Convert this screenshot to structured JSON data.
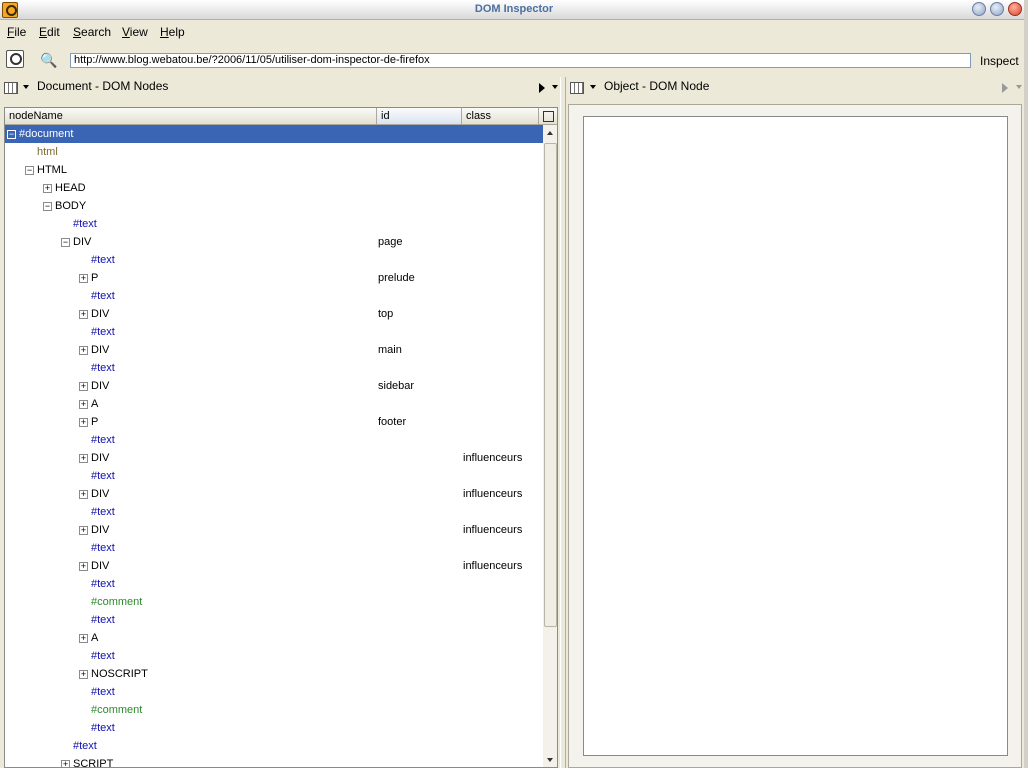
{
  "window": {
    "title": "DOM Inspector"
  },
  "menu": {
    "file": "File",
    "file_key": "F",
    "file_rest": "ile",
    "edit": "Edit",
    "edit_key": "E",
    "edit_rest": "dit",
    "search": "Search",
    "search_key": "S",
    "search_rest": "earch",
    "view": "View",
    "view_key": "V",
    "view_rest": "iew",
    "help": "Help",
    "help_key": "H",
    "help_rest": "elp"
  },
  "toolbar": {
    "url": "http://www.blog.webatou.be/?2006/11/05/utiliser-dom-inspector-de-firefox",
    "inspect_label": "Inspect"
  },
  "left_pane": {
    "title": "Document - DOM Nodes",
    "columns": {
      "nodename": "nodeName",
      "id": "id",
      "class": "class"
    },
    "rows": [
      {
        "name": "#document",
        "id": "",
        "class": "",
        "toggle": "−",
        "type": "normal",
        "level": 0
      },
      {
        "name": "html",
        "id": "",
        "class": "",
        "toggle": "",
        "type": "dt",
        "level": 1
      },
      {
        "name": "HTML",
        "id": "",
        "class": "",
        "toggle": "−",
        "type": "normal",
        "level": 1
      },
      {
        "name": "HEAD",
        "id": "",
        "class": "",
        "toggle": "+",
        "type": "normal",
        "level": 2
      },
      {
        "name": "BODY",
        "id": "",
        "class": "",
        "toggle": "−",
        "type": "normal",
        "level": 2
      },
      {
        "name": "#text",
        "id": "",
        "class": "",
        "toggle": "",
        "type": "text",
        "level": 3
      },
      {
        "name": "DIV",
        "id": "page",
        "class": "",
        "toggle": "−",
        "type": "normal",
        "level": 3
      },
      {
        "name": "#text",
        "id": "",
        "class": "",
        "toggle": "",
        "type": "text",
        "level": 4
      },
      {
        "name": "P",
        "id": "prelude",
        "class": "",
        "toggle": "+",
        "type": "normal",
        "level": 4
      },
      {
        "name": "#text",
        "id": "",
        "class": "",
        "toggle": "",
        "type": "text",
        "level": 4
      },
      {
        "name": "DIV",
        "id": "top",
        "class": "",
        "toggle": "+",
        "type": "normal",
        "level": 4
      },
      {
        "name": "#text",
        "id": "",
        "class": "",
        "toggle": "",
        "type": "text",
        "level": 4
      },
      {
        "name": "DIV",
        "id": "main",
        "class": "",
        "toggle": "+",
        "type": "normal",
        "level": 4
      },
      {
        "name": "#text",
        "id": "",
        "class": "",
        "toggle": "",
        "type": "text",
        "level": 4
      },
      {
        "name": "DIV",
        "id": "sidebar",
        "class": "",
        "toggle": "+",
        "type": "normal",
        "level": 4
      },
      {
        "name": "A",
        "id": "",
        "class": "",
        "toggle": "+",
        "type": "normal",
        "level": 4
      },
      {
        "name": "P",
        "id": "footer",
        "class": "",
        "toggle": "+",
        "type": "normal",
        "level": 4
      },
      {
        "name": "#text",
        "id": "",
        "class": "",
        "toggle": "",
        "type": "text",
        "level": 4
      },
      {
        "name": "DIV",
        "id": "",
        "class": "influenceurs",
        "toggle": "+",
        "type": "normal",
        "level": 4
      },
      {
        "name": "#text",
        "id": "",
        "class": "",
        "toggle": "",
        "type": "text",
        "level": 4
      },
      {
        "name": "DIV",
        "id": "",
        "class": "influenceurs",
        "toggle": "+",
        "type": "normal",
        "level": 4
      },
      {
        "name": "#text",
        "id": "",
        "class": "",
        "toggle": "",
        "type": "text",
        "level": 4
      },
      {
        "name": "DIV",
        "id": "",
        "class": "influenceurs",
        "toggle": "+",
        "type": "normal",
        "level": 4
      },
      {
        "name": "#text",
        "id": "",
        "class": "",
        "toggle": "",
        "type": "text",
        "level": 4
      },
      {
        "name": "DIV",
        "id": "",
        "class": "influenceurs",
        "toggle": "+",
        "type": "normal",
        "level": 4
      },
      {
        "name": "#text",
        "id": "",
        "class": "",
        "toggle": "",
        "type": "text",
        "level": 4
      },
      {
        "name": "#comment",
        "id": "",
        "class": "",
        "toggle": "",
        "type": "comment",
        "level": 4
      },
      {
        "name": "#text",
        "id": "",
        "class": "",
        "toggle": "",
        "type": "text",
        "level": 4
      },
      {
        "name": "A",
        "id": "",
        "class": "",
        "toggle": "+",
        "type": "normal",
        "level": 4
      },
      {
        "name": "#text",
        "id": "",
        "class": "",
        "toggle": "",
        "type": "text",
        "level": 4
      },
      {
        "name": "NOSCRIPT",
        "id": "",
        "class": "",
        "toggle": "+",
        "type": "normal",
        "level": 4
      },
      {
        "name": "#text",
        "id": "",
        "class": "",
        "toggle": "",
        "type": "text",
        "level": 4
      },
      {
        "name": "#comment",
        "id": "",
        "class": "",
        "toggle": "",
        "type": "comment",
        "level": 4
      },
      {
        "name": "#text",
        "id": "",
        "class": "",
        "toggle": "",
        "type": "text",
        "level": 4
      },
      {
        "name": "#text",
        "id": "",
        "class": "",
        "toggle": "",
        "type": "text",
        "level": 3
      },
      {
        "name": "SCRIPT",
        "id": "",
        "class": "",
        "toggle": "+",
        "type": "normal",
        "level": 3
      }
    ]
  },
  "right_pane": {
    "title": "Object - DOM Node"
  }
}
